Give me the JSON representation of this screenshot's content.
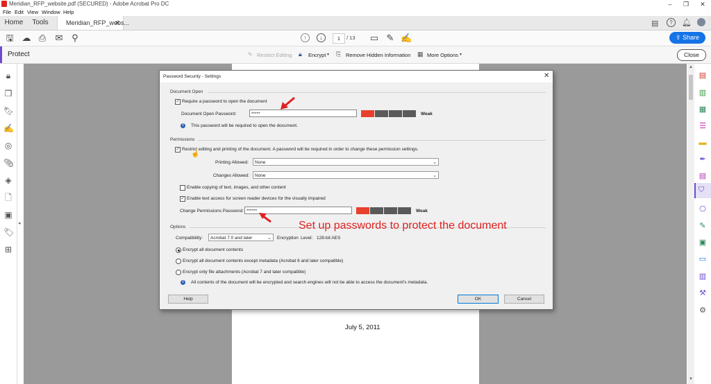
{
  "window": {
    "title": "Meridian_RFP_website.pdf (SECURED) - Adobe Acrobat Pro DC"
  },
  "menu": [
    "File",
    "Edit",
    "View",
    "Window",
    "Help"
  ],
  "tabs": {
    "home": "Home",
    "tools": "Tools",
    "doc": "Meridian_RFP_webs..."
  },
  "toolbar": {
    "page_current": "1",
    "page_total": "/ 13",
    "share": "Share"
  },
  "protect_bar": {
    "title": "Protect",
    "restrict_editing": "Restrict Editing",
    "encrypt": "Encrypt",
    "remove_hidden": "Remove Hidden Information",
    "more_options": "More Options",
    "close": "Close"
  },
  "dialog": {
    "title": "Password Security - Settings",
    "document_open": {
      "section": "Document Open",
      "require_label": "Require a password to open the document",
      "password_label": "Document Open Password:",
      "password_value": "*****",
      "strength": "Weak",
      "info": "This password will be required to open the document."
    },
    "permissions": {
      "section": "Permissions",
      "restrict_label": "Restrict editing and printing of the document. A password will be required in order to change these permission settings.",
      "printing_label": "Printing Allowed:",
      "printing_value": "None",
      "changes_label": "Changes Allowed:",
      "changes_value": "None",
      "copy_label": "Enable copying of text, images, and other content",
      "screenreader_label": "Enable text access for screen reader devices for the visually impaired",
      "password_label": "Change Permissions Password:",
      "password_value": "******",
      "strength": "Weak"
    },
    "options": {
      "section": "Options",
      "compat_label": "Compatibility:",
      "compat_value": "Acrobat 7.0 and later",
      "encryption_label": "Encryption",
      "encryption_level_label": "Level:",
      "encryption_level_value": "128-bit AES",
      "radio1": "Encrypt all document contents",
      "radio2": "Encrypt all document contents except metadata (Acrobat 6 and later compatible)",
      "radio3": "Encrypt only file attachments (Acrobat 7 and later compatible)",
      "info": "All contents of the document will be encrypted and search engines will not be able to access the document's metadata."
    },
    "buttons": {
      "help": "Help",
      "ok": "OK",
      "cancel": "Cancel"
    }
  },
  "annotation": "Set up passwords to protect the document",
  "page_date": "July 5, 2011",
  "colors": {
    "strength_on": "#e8402c",
    "strength_off": "#5a5a5a",
    "accent": "#1473e6",
    "annotation": "#e02020",
    "protect_accent": "#6d4bd1"
  }
}
